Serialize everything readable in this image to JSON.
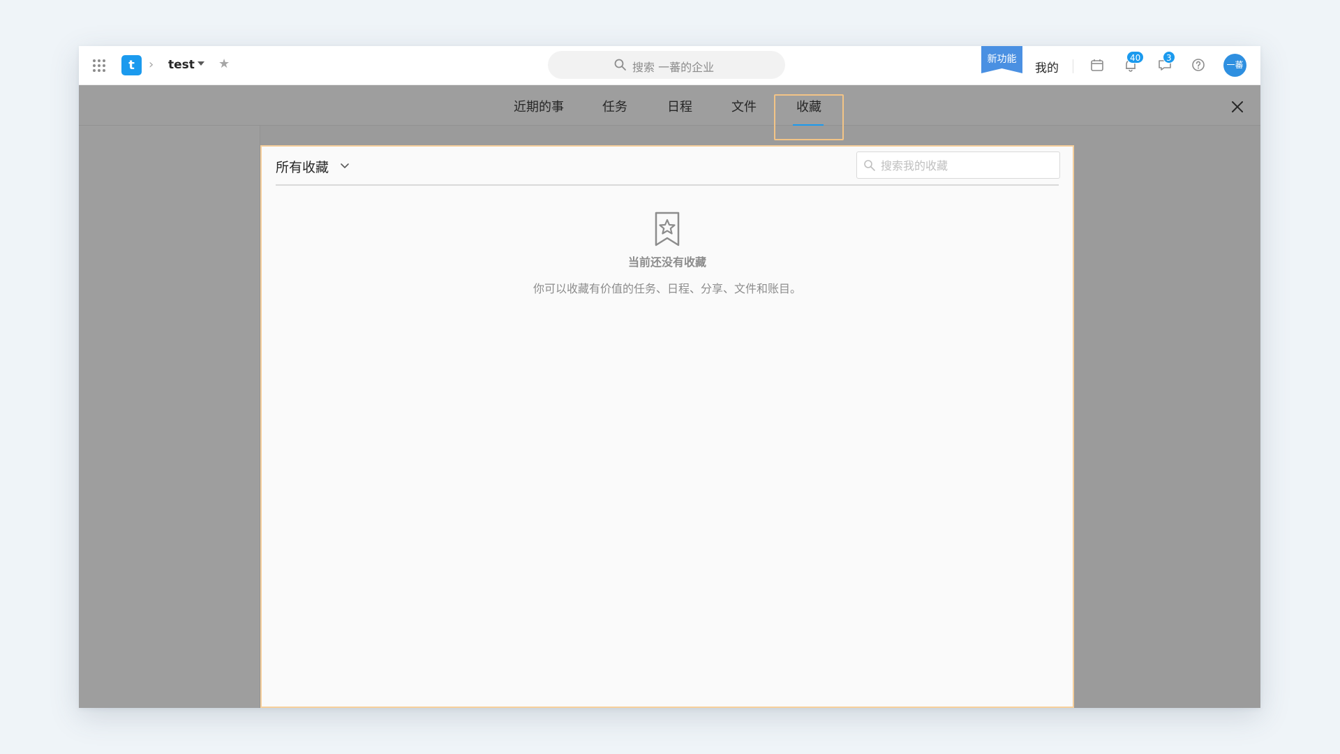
{
  "topbar": {
    "project_name": "test",
    "global_search_placeholder": "搜索 一蕃的企业",
    "new_feature_label": "新功能",
    "mine_label": "我的",
    "notification_count": "40",
    "message_count": "3",
    "avatar_text": "一蕃"
  },
  "overlay_tabs": {
    "items": [
      {
        "label": "近期的事",
        "icon": null
      },
      {
        "label": "任务",
        "icon": null
      },
      {
        "label": "日程",
        "icon": null
      },
      {
        "label": "文件",
        "icon": null
      },
      {
        "label": "收藏",
        "icon": null
      }
    ],
    "active_index": 4
  },
  "favorites_panel": {
    "filter_label": "所有收藏",
    "search_placeholder": "搜索我的收藏",
    "empty_title": "当前还没有收藏",
    "empty_description": "你可以收藏有价值的任务、日程、分享、文件和账目。"
  },
  "icons": {
    "apps": "apps-grid-icon",
    "star": "star-icon",
    "search": "search-icon",
    "calendar": "calendar-icon",
    "bell": "bell-icon",
    "message": "message-icon",
    "help": "help-icon",
    "close": "close-icon",
    "chevron": "chevron-down-icon",
    "bookmark": "bookmark-star-icon"
  },
  "colors": {
    "accent": "#1b9aee",
    "new_feature_bg": "#4a90e2",
    "highlight_border": "#f3c486"
  }
}
